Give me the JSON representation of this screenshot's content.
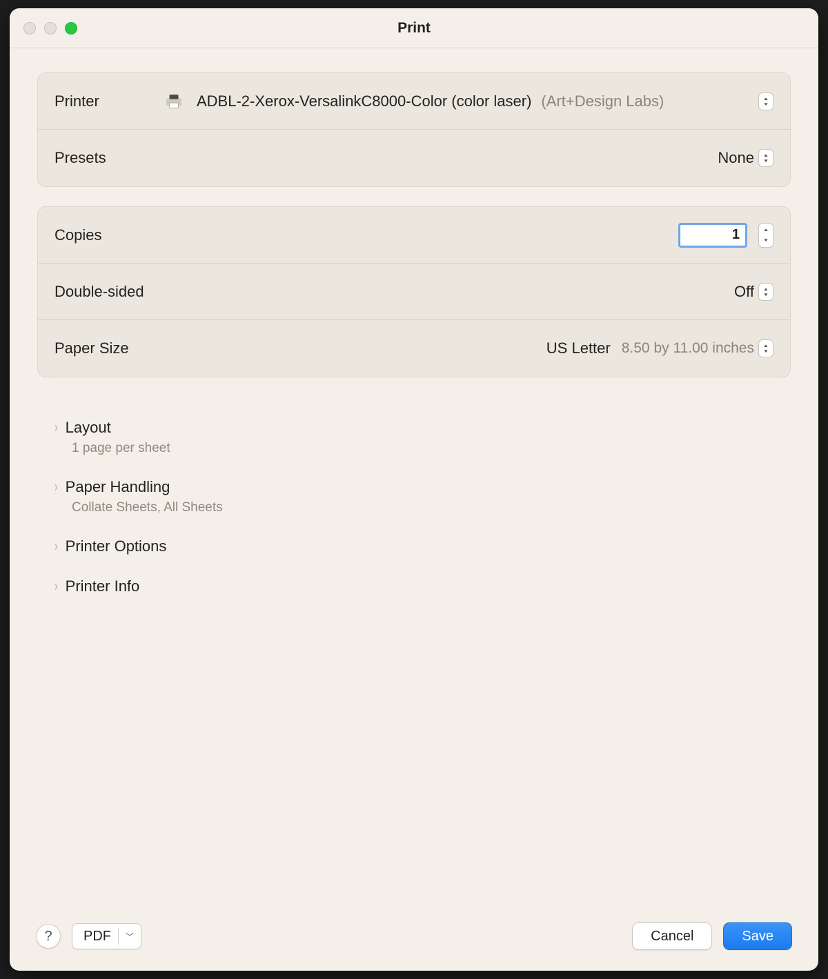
{
  "window": {
    "title": "Print"
  },
  "panel1": {
    "printer_label": "Printer",
    "printer_name": "ADBL-2-Xerox-VersalinkC8000-Color (color laser)",
    "printer_location": "(Art+Design Labs)",
    "presets_label": "Presets",
    "presets_value": "None"
  },
  "panel2": {
    "copies_label": "Copies",
    "copies_value": "1",
    "double_label": "Double-sided",
    "double_value": "Off",
    "paper_label": "Paper Size",
    "paper_value": "US Letter",
    "paper_detail": "8.50 by 11.00 inches"
  },
  "disclosures": {
    "layout_title": "Layout",
    "layout_sub": "1 page per sheet",
    "ph_title": "Paper Handling",
    "ph_sub": "Collate Sheets, All Sheets",
    "po_title": "Printer Options",
    "pi_title": "Printer Info"
  },
  "footer": {
    "help": "?",
    "pdf": "PDF",
    "cancel": "Cancel",
    "save": "Save"
  }
}
